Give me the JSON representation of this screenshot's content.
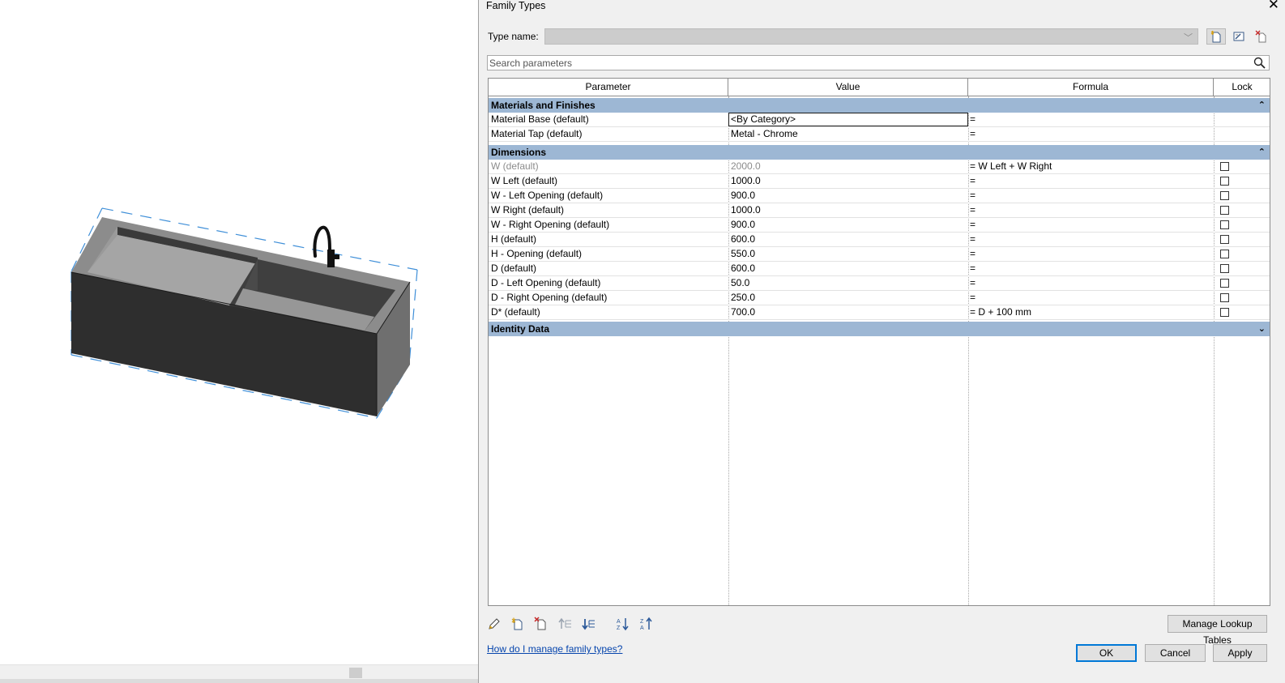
{
  "dialog": {
    "title": "Family Types",
    "close_glyph": "✕",
    "type_name_label": "Type name:",
    "type_name_value": "",
    "search_placeholder": "Search parameters",
    "columns": [
      "Parameter",
      "Value",
      "Formula",
      "Lock"
    ],
    "groups": [
      {
        "name": "Materials and Finishes",
        "chevron": "⌃",
        "rows": [
          {
            "param": "Material Base (default)",
            "value": "<By Category>",
            "formula": "=",
            "lock": null,
            "editing": true
          },
          {
            "param": "Material Tap (default)",
            "value": "Metal - Chrome",
            "formula": "=",
            "lock": null
          }
        ]
      },
      {
        "name": "Dimensions",
        "chevron": "⌃",
        "rows": [
          {
            "param": "W (default)",
            "value": "2000.0",
            "formula": "= W Left + W Right",
            "lock": false,
            "greyed": true
          },
          {
            "param": "W Left (default)",
            "value": "1000.0",
            "formula": "=",
            "lock": false
          },
          {
            "param": "W - Left Opening (default)",
            "value": "900.0",
            "formula": "=",
            "lock": false
          },
          {
            "param": "W Right (default)",
            "value": "1000.0",
            "formula": "=",
            "lock": false
          },
          {
            "param": "W - Right Opening (default)",
            "value": "900.0",
            "formula": "=",
            "lock": false
          },
          {
            "param": "H (default)",
            "value": "600.0",
            "formula": "=",
            "lock": false
          },
          {
            "param": "H - Opening (default)",
            "value": "550.0",
            "formula": "=",
            "lock": false
          },
          {
            "param": "D (default)",
            "value": "600.0",
            "formula": "=",
            "lock": false
          },
          {
            "param": "D - Left Opening (default)",
            "value": "50.0",
            "formula": "=",
            "lock": false
          },
          {
            "param": "D - Right Opening (default)",
            "value": "250.0",
            "formula": "=",
            "lock": false
          },
          {
            "param": "D* (default)",
            "value": "700.0",
            "formula": "= D + 100 mm",
            "lock": false
          }
        ]
      },
      {
        "name": "Identity Data",
        "chevron": "⌄",
        "rows": []
      }
    ],
    "manage_lookup_label": "Manage Lookup Tables",
    "help_link": "How do I manage family types?",
    "ok_label": "OK",
    "cancel_label": "Cancel",
    "apply_label": "Apply",
    "toolbar_icons": [
      "pencil-icon",
      "new-parameter-icon",
      "delete-parameter-icon",
      "move-up-icon",
      "move-down-icon",
      "sort-ascending-icon",
      "sort-descending-icon"
    ]
  },
  "colors": {
    "group_header": "#9db7d4",
    "dialog_bg": "#f0f0f0",
    "sink_body": "#2e2e2e",
    "sink_top": "#8a8a8a",
    "selection_dash": "#3f8fd8"
  }
}
